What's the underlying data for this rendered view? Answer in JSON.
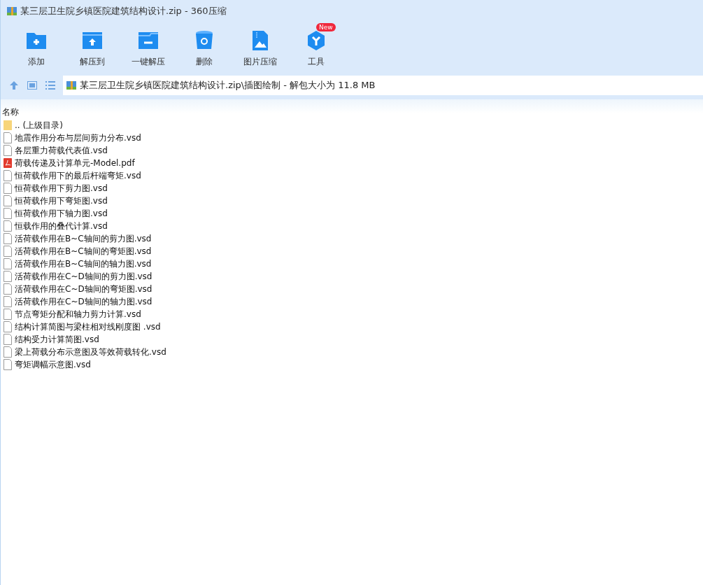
{
  "window": {
    "title": "某三层卫生院乡镇医院建筑结构设计.zip - 360压缩"
  },
  "toolbar": [
    {
      "kind": "add",
      "label": "添加"
    },
    {
      "kind": "extract",
      "label": "解压到"
    },
    {
      "kind": "oneclick",
      "label": "一键解压"
    },
    {
      "kind": "delete",
      "label": "删除"
    },
    {
      "kind": "image",
      "label": "图片压缩"
    },
    {
      "kind": "tools",
      "label": "工具",
      "badge": "New"
    }
  ],
  "address": {
    "path": "某三层卫生院乡镇医院建筑结构设计.zip\\插图绘制 - 解包大小为 11.8 MB"
  },
  "table": {
    "columns": [
      "名称"
    ],
    "rows": [
      {
        "kind": "folder",
        "name": ".. (上级目录)"
      },
      {
        "kind": "file",
        "name": "地震作用分布与层间剪力分布.vsd"
      },
      {
        "kind": "file",
        "name": "各层重力荷载代表值.vsd"
      },
      {
        "kind": "pdf",
        "name": "荷载传递及计算单元-Model.pdf"
      },
      {
        "kind": "file",
        "name": "恒荷载作用下的最后杆端弯矩.vsd"
      },
      {
        "kind": "file",
        "name": "恒荷载作用下剪力图.vsd"
      },
      {
        "kind": "file",
        "name": "恒荷载作用下弯矩图.vsd"
      },
      {
        "kind": "file",
        "name": "恒荷载作用下轴力图.vsd"
      },
      {
        "kind": "file",
        "name": "恒载作用的叠代计算.vsd"
      },
      {
        "kind": "file",
        "name": "活荷载作用在B~C轴间的剪力图.vsd"
      },
      {
        "kind": "file",
        "name": "活荷载作用在B~C轴间的弯矩图.vsd"
      },
      {
        "kind": "file",
        "name": "活荷载作用在B~C轴间的轴力图.vsd"
      },
      {
        "kind": "file",
        "name": "活荷载作用在C~D轴间的剪力图.vsd"
      },
      {
        "kind": "file",
        "name": "活荷载作用在C~D轴间的弯矩图.vsd"
      },
      {
        "kind": "file",
        "name": "活荷载作用在C~D轴间的轴力图.vsd"
      },
      {
        "kind": "file",
        "name": "节点弯矩分配和轴力剪力计算.vsd"
      },
      {
        "kind": "file",
        "name": "结构计算简图与梁柱相对线刚度图 .vsd"
      },
      {
        "kind": "file",
        "name": "结构受力计算简图.vsd"
      },
      {
        "kind": "file",
        "name": "梁上荷载分布示意图及等效荷载转化.vsd"
      },
      {
        "kind": "file",
        "name": "弯矩调幅示意图.vsd"
      }
    ]
  }
}
